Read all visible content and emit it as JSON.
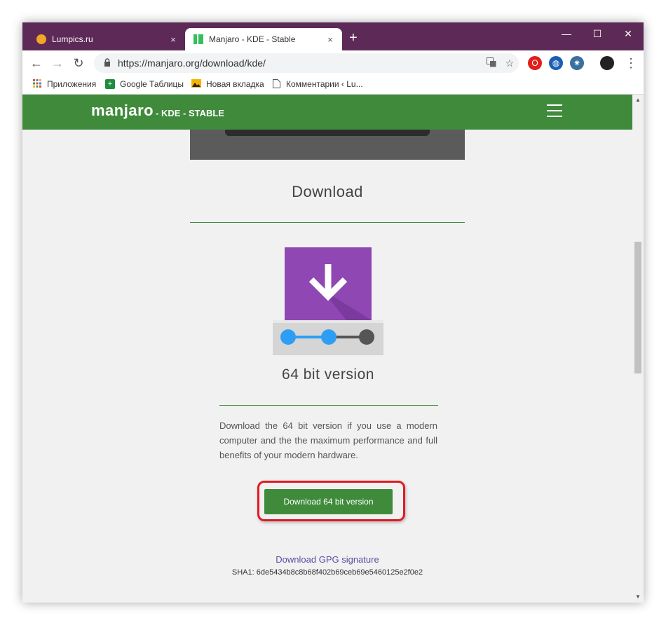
{
  "browser": {
    "tabs": [
      {
        "title": "Lumpics.ru",
        "close": "×"
      },
      {
        "title": "Manjaro - KDE - Stable",
        "close": "×"
      }
    ],
    "new_tab": "+",
    "window_controls": {
      "minimize": "—",
      "maximize": "☐",
      "close": "✕"
    },
    "url": "https://manjaro.org/download/kde/",
    "bookmarks": [
      {
        "label": "Приложения",
        "icon": "apps-grid-icon"
      },
      {
        "label": "Google Таблицы",
        "icon": "sheets-icon"
      },
      {
        "label": "Новая вкладка",
        "icon": "image-icon"
      },
      {
        "label": "Комментарии ‹ Lu...",
        "icon": "page-icon"
      }
    ]
  },
  "site": {
    "logo": "manjaro",
    "edition": "- KDE - STABLE",
    "section_heading": "Download",
    "version_heading": "64 bit version",
    "description": "Download the 64 bit version if you use a modern computer and the the maximum performance and full benefits of your modern hardware.",
    "download_button": "Download 64 bit version",
    "gpg_link": "Download GPG signature",
    "sha1": "SHA1: 6de5434b8c8b68f402b69ceb69e5460125e2f0e2"
  },
  "colors": {
    "titlebar": "#5d2a57",
    "brand_green": "#3f8b3b",
    "highlight_red": "#e01b22",
    "icon_purple": "#8e44ad",
    "progress_blue": "#2e9ef4"
  }
}
